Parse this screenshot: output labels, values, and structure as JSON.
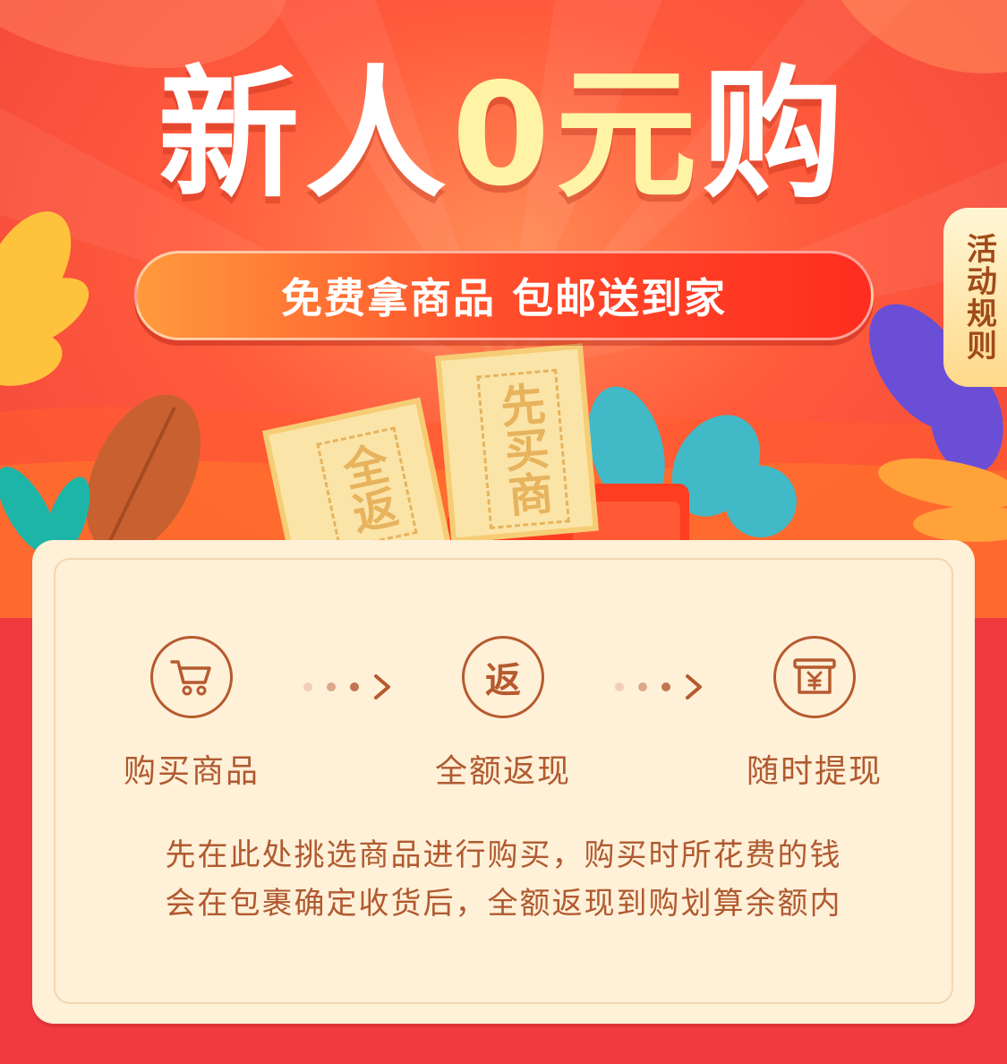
{
  "hero": {
    "title_part1": "新人",
    "title_zero": "0",
    "title_part2": "元",
    "title_part3": "购",
    "subtitle": "免费拿商品 包邮送到家",
    "rules_button": "活动规则",
    "ticket_left": "全返",
    "ticket_right": "先买商"
  },
  "steps": [
    {
      "label": "购买商品",
      "icon": "shopping-cart-icon"
    },
    {
      "label": "全额返现",
      "icon_text": "返",
      "icon": "refund-icon"
    },
    {
      "label": "随时提现",
      "icon": "withdraw-icon"
    }
  ],
  "description": {
    "line1": "先在此处挑选商品进行购买，购买时所花费的钱",
    "line2": "会在包裹确定收货后，全额返现到购划算余额内"
  },
  "colors": {
    "accent_brown": "#b65a2f",
    "card_bg": "#fff0d8",
    "background_red": "#f03a3f"
  }
}
